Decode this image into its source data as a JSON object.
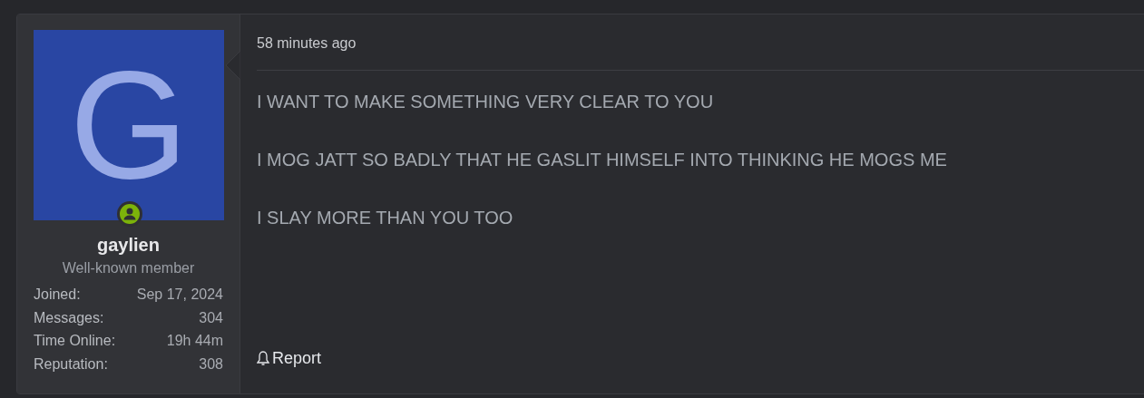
{
  "author": {
    "avatar_letter": "G",
    "online": true,
    "username": "gaylien",
    "title": "Well-known member",
    "stats": [
      {
        "label": "Joined:",
        "value": "Sep 17, 2024"
      },
      {
        "label": "Messages:",
        "value": "304"
      },
      {
        "label": "Time Online:",
        "value": "19h 44m"
      },
      {
        "label": "Reputation:",
        "value": "308"
      }
    ]
  },
  "post": {
    "time": "58 minutes ago",
    "paragraphs": [
      "I WANT TO MAKE SOMETHING VERY CLEAR TO YOU",
      "I MOG JATT SO BADLY THAT HE GASLIT HIMSELF INTO THINKING HE MOGS ME",
      "I SLAY MORE THAN YOU TOO"
    ],
    "actions": [
      {
        "kind": "report",
        "label": "Report"
      }
    ]
  }
}
